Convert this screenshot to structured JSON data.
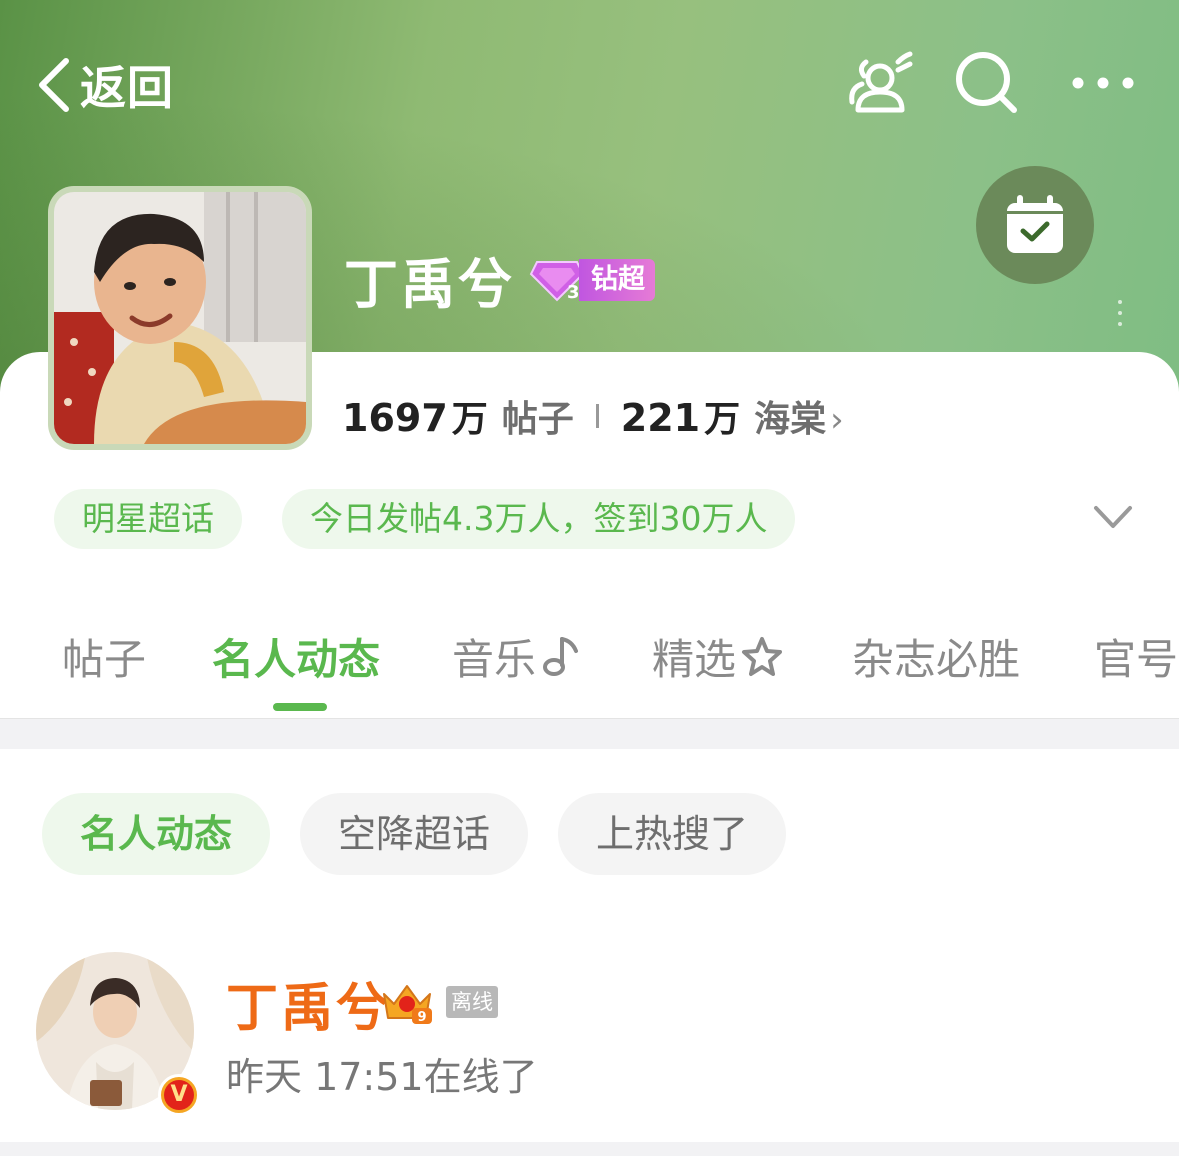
{
  "nav": {
    "back_label": "返回"
  },
  "header": {
    "title": "丁禹兮",
    "badge_level": "3",
    "badge_label": "钻超",
    "icons": [
      "people-icon",
      "search-icon",
      "more-icon",
      "checkin-calendar-icon"
    ]
  },
  "stats": {
    "posts_count": "1697",
    "posts_unit": "万",
    "posts_label": "帖子",
    "fans_count": "221",
    "fans_unit": "万",
    "fans_label": "海棠",
    "fans_arrow": "›"
  },
  "chips": {
    "category": "明星超话",
    "activity": "今日发帖4.3万人，签到30万人"
  },
  "tabs": [
    {
      "label": "帖子"
    },
    {
      "label": "名人动态"
    },
    {
      "label": "音乐"
    },
    {
      "label": "精选"
    },
    {
      "label": "杂志必胜"
    },
    {
      "label": "官号"
    }
  ],
  "subtabs": [
    {
      "label": "名人动态"
    },
    {
      "label": "空降超话"
    },
    {
      "label": "上热搜了"
    }
  ],
  "user": {
    "name": "丁禹兮",
    "crown_level": "9",
    "status_tag": "离线",
    "last_online": "昨天 17:51在线了",
    "verified_mark": "V"
  },
  "colors": {
    "accent_green": "#5ab84e",
    "name_orange": "#ee6a16",
    "badge_purple": "#c056e0"
  }
}
